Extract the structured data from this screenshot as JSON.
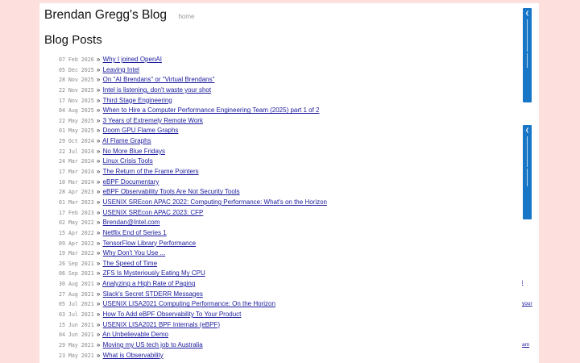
{
  "site": {
    "title": "Brendan Gregg's Blog",
    "home_label": "home"
  },
  "main": {
    "heading": "Blog Posts"
  },
  "posts": [
    {
      "date": "07 Feb 2026",
      "title": "Why I joined OpenAI"
    },
    {
      "date": "05 Dec 2025",
      "title": "Leaving Intel"
    },
    {
      "date": "28 Nov 2025",
      "title": "On \"AI Brendans\" or \"Virtual Brendans\""
    },
    {
      "date": "22 Nov 2025",
      "title": "Intel is listening, don't waste your shot"
    },
    {
      "date": "17 Nov 2025",
      "title": "Third Stage Engineering"
    },
    {
      "date": "04 Aug 2025",
      "title": "When to Hire a Computer Performance Engineering Team (2025) part 1 of 2"
    },
    {
      "date": "22 May 2025",
      "title": "3 Years of Extremely Remote Work"
    },
    {
      "date": "01 May 2025",
      "title": "Doom GPU Flame Graphs"
    },
    {
      "date": "29 Oct 2024",
      "title": "AI Flame Graphs"
    },
    {
      "date": "22 Jul 2024",
      "title": "No More Blue Fridays"
    },
    {
      "date": "24 Mar 2024",
      "title": "Linux Crisis Tools"
    },
    {
      "date": "17 Mar 2024",
      "title": "The Return of the Frame Pointers"
    },
    {
      "date": "10 Mar 2024",
      "title": "eBPF Documentary"
    },
    {
      "date": "28 Apr 2023",
      "title": "eBPF Observability Tools Are Not Security Tools"
    },
    {
      "date": "01 Mar 2023",
      "title": "USENIX SREcon APAC 2022: Computing Performance: What's on the Horizon"
    },
    {
      "date": "17 Feb 2023",
      "title": "USENIX SREcon APAC 2023: CFP"
    },
    {
      "date": "02 May 2022",
      "title": "Brendan@Intel.com"
    },
    {
      "date": "15 Apr 2022",
      "title": "Netflix End of Series 1"
    },
    {
      "date": "09 Apr 2022",
      "title": "TensorFlow Library Performance"
    },
    {
      "date": "19 Mar 2022",
      "title": "Why Don't You Use ..."
    },
    {
      "date": "26 Sep 2021",
      "title": "The Speed of Time"
    },
    {
      "date": "06 Sep 2021",
      "title": "ZFS Is Mysteriously Eating My CPU"
    },
    {
      "date": "30 Aug 2021",
      "title": "Analyzing a High Rate of Paging"
    },
    {
      "date": "27 Aug 2021",
      "title": "Slack's Secret STDERR Messages"
    },
    {
      "date": "05 Jul 2021",
      "title": "USENIX LISA2021 Computing Performance: On the Horizon"
    },
    {
      "date": "03 Jul 2021",
      "title": "How To Add eBPF Observability To Your Product"
    },
    {
      "date": "15 Jun 2021",
      "title": "USENIX LISA2021 BPF Internals (eBPF)"
    },
    {
      "date": "04 Jun 2021",
      "title": "An Unbelievable Demo"
    },
    {
      "date": "29 May 2021",
      "title": "Moving my US tech job to Australia"
    },
    {
      "date": "23 May 2021",
      "title": "What is Observability"
    },
    {
      "date": "",
      "title": ""
    }
  ],
  "edge": {
    "bits": [
      "l",
      "your",
      "am"
    ]
  },
  "colors": {
    "background": "#fde0de",
    "link": "#1a1a9e",
    "tab": "#1976c6"
  }
}
